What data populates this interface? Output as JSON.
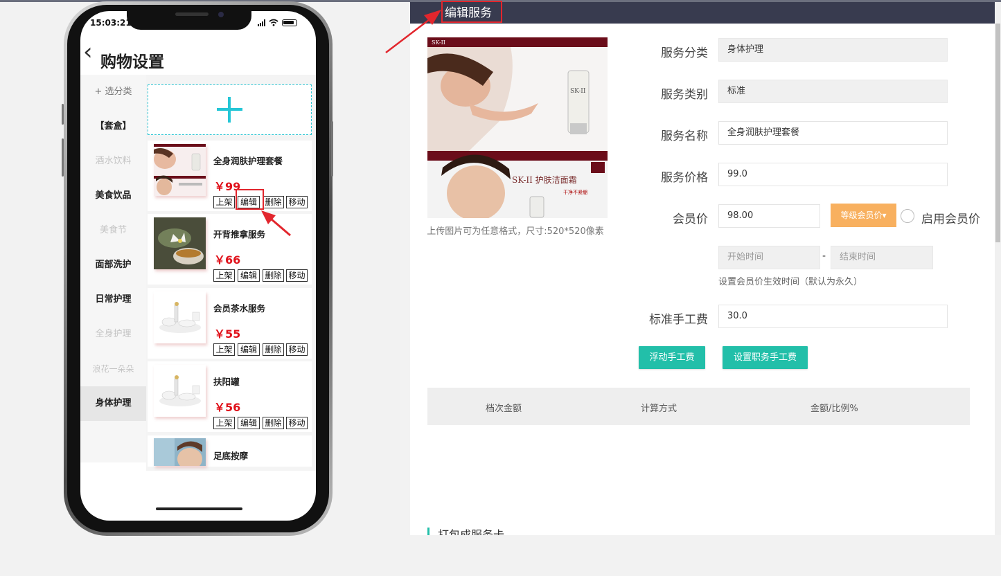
{
  "phone": {
    "status_time": "15:03:21",
    "nav_back_glyph": "‹",
    "nav_title": "购物设置",
    "categories": [
      {
        "label": "+ 选分类"
      },
      {
        "label": "【套盒】"
      },
      {
        "label": "酒水饮料"
      },
      {
        "label": "美食饮品"
      },
      {
        "label": "美食节"
      },
      {
        "label": "面部洗护"
      },
      {
        "label": "日常护理"
      },
      {
        "label": "全身护理"
      },
      {
        "label": "浪花一朵朵"
      },
      {
        "label": "身体护理"
      }
    ],
    "actions": {
      "shelf": "上架",
      "edit": "编辑",
      "delete": "删除",
      "move": "移动"
    },
    "products": [
      {
        "name": "全身润肤护理套餐",
        "price": "￥99"
      },
      {
        "name": "开背推拿服务",
        "price": "￥66"
      },
      {
        "name": "会员茶水服务",
        "price": "￥55"
      },
      {
        "name": "扶阳罐",
        "price": "￥56"
      },
      {
        "name": "足底按摩",
        "price": ""
      }
    ]
  },
  "panel": {
    "title": "编辑服务",
    "banner": {
      "brand": "SK-II",
      "slogan": "SK-II 护肤洁面霜",
      "sub": "干净不紧绷"
    },
    "upload_hint": "上传图片可为任意格式，尺寸:520*520像素",
    "fields": {
      "category_label": "服务分类",
      "category_value": "身体护理",
      "type_label": "服务类别",
      "type_value": "标准",
      "name_label": "服务名称",
      "name_value": "全身润肤护理套餐",
      "price_label": "服务价格",
      "price_value": "99.0",
      "member_label": "会员价",
      "member_value": "98.00",
      "level_button": "等级会员价▾",
      "enable_member": "启用会员价",
      "start_placeholder": "开始时间",
      "end_placeholder": "结束时间",
      "range_dash": "-",
      "time_hint": "设置会员价生效时间（默认为永久）",
      "fee_label": "标准手工费",
      "fee_value": "30.0"
    },
    "buttons": {
      "float_fee": "浮动手工费",
      "role_fee": "设置职务手工费"
    },
    "table_headers": [
      "档次金额",
      "计算方式",
      "金额/比例%"
    ],
    "section_title": "打包成服务卡"
  },
  "colors": {
    "accent": "#22bfa9",
    "header": "#383b4f",
    "price": "#e0121b",
    "highlight": "#e2262d",
    "orange": "#f8b05f"
  }
}
